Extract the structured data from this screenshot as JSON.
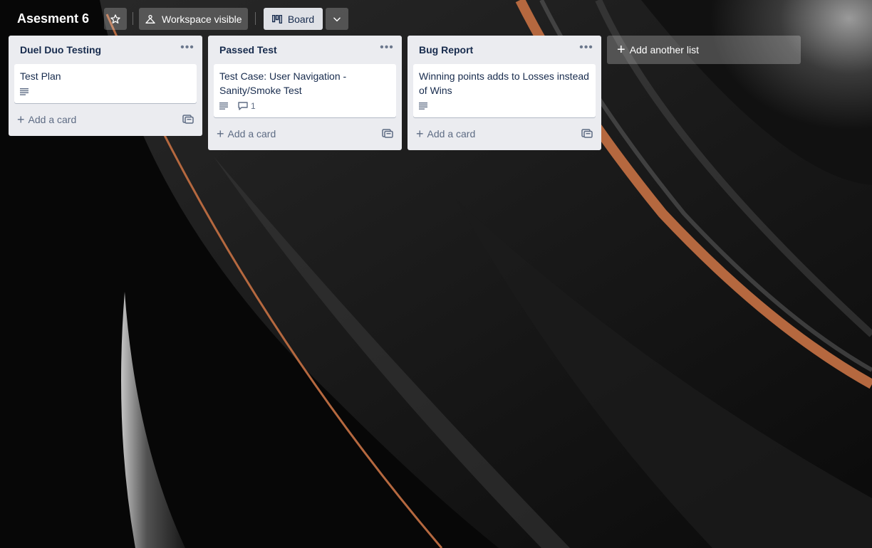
{
  "board": {
    "title": "Asesment 6",
    "visibility_label": "Workspace visible",
    "view_label": "Board"
  },
  "lists": [
    {
      "title": "Duel Duo Testing",
      "cards": [
        {
          "title": "Test Plan",
          "has_description": true
        }
      ],
      "add_card_label": "Add a card"
    },
    {
      "title": "Passed Test",
      "cards": [
        {
          "title": "Test Case: User Navigation - Sanity/Smoke Test",
          "has_description": true,
          "comments": "1"
        }
      ],
      "add_card_label": "Add a card"
    },
    {
      "title": "Bug Report",
      "cards": [
        {
          "title": "Winning points adds to Losses instead of Wins",
          "has_description": true
        }
      ],
      "add_card_label": "Add a card"
    }
  ],
  "add_list_label": "Add another list",
  "colors": {
    "background": "#0d0d0d",
    "list_bg": "#ebecf0",
    "accent_copper": "#b5683f",
    "text_dark": "#172b4d",
    "text_muted": "#5e6c84"
  },
  "icons": {
    "star": "star-icon",
    "visibility": "workspace-visible-icon",
    "board": "board-icon",
    "chevron": "chevron-down-icon",
    "menu": "ellipsis-icon",
    "description": "description-icon",
    "comment": "comment-icon",
    "template": "card-template-icon",
    "plus": "plus-icon"
  }
}
